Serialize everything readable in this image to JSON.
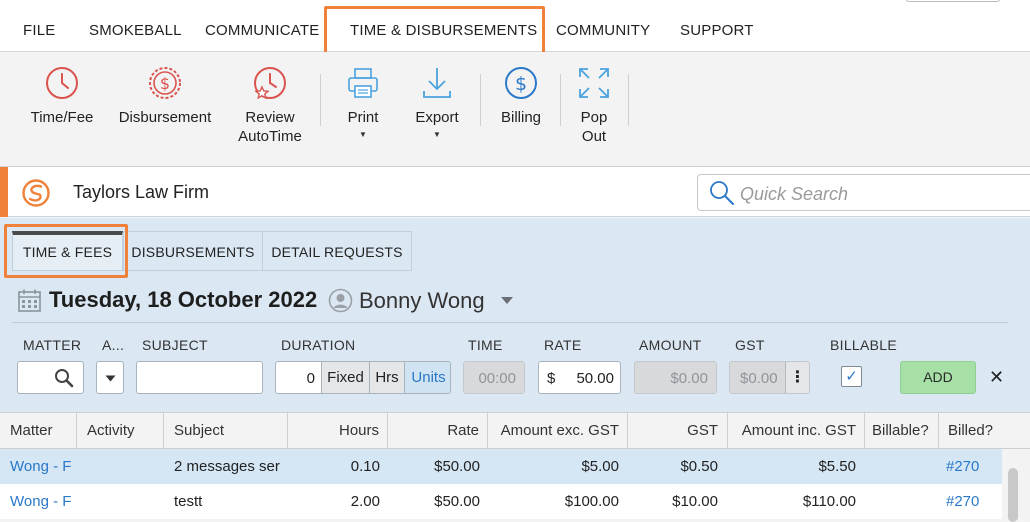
{
  "menu": {
    "items": [
      "FILE",
      "SMOKEBALL",
      "COMMUNICATE",
      "TIME & DISBURSEMENTS",
      "COMMUNITY",
      "SUPPORT"
    ],
    "active": "TIME & DISBURSEMENTS"
  },
  "ribbon": {
    "time_fee": "Time/Fee",
    "disbursement": "Disbursement",
    "review_line1": "Review",
    "review_line2": "AutoTime",
    "print": "Print",
    "export": "Export",
    "billing": "Billing",
    "popout_line1": "Pop",
    "popout_line2": "Out",
    "caret": "▼"
  },
  "firm": {
    "name": "Taylors Law Firm"
  },
  "search": {
    "placeholder": "Quick Search"
  },
  "tabs": [
    "TIME & FEES",
    "DISBURSEMENTS",
    "DETAIL REQUESTS"
  ],
  "header": {
    "date": "Tuesday, 18 October 2022",
    "person": "Bonny Wong"
  },
  "entry": {
    "labels": {
      "matter": "MATTER",
      "activity": "A...",
      "subject": "SUBJECT",
      "duration": "DURATION",
      "time": "TIME",
      "rate": "RATE",
      "amount": "AMOUNT",
      "gst": "GST",
      "billable": "BILLABLE"
    },
    "duration_value": "0",
    "duration_modes": [
      "Fixed",
      "Hrs",
      "Units"
    ],
    "time_value": "00:00",
    "rate_currency": "$",
    "rate_value": "50.00",
    "amount_value": "$0.00",
    "gst_value": "$0.00",
    "more": "⋮",
    "billable_check": "✓",
    "add": "ADD",
    "close": "✕"
  },
  "table": {
    "headers": [
      "Matter",
      "Activity",
      "Subject",
      "Hours",
      "Rate",
      "Amount exc. GST",
      "GST",
      "Amount inc. GST",
      "Billable?",
      "Billed?"
    ],
    "rows": [
      {
        "matter": "Wong - F",
        "activity": "",
        "subject": "2 messages ser",
        "hours": "0.10",
        "rate": "$50.00",
        "amount_exc": "$5.00",
        "gst": "$0.50",
        "amount_inc": "$5.50",
        "billable": "",
        "billed": "#270"
      },
      {
        "matter": "Wong - F",
        "activity": "",
        "subject": "testt",
        "hours": "2.00",
        "rate": "$50.00",
        "amount_exc": "$100.00",
        "gst": "$10.00",
        "amount_inc": "$110.00",
        "billable": "",
        "billed": "#270"
      }
    ]
  },
  "colors": {
    "accent": "#f0813b",
    "link": "#2a78c8",
    "icon_red": "#d9534f",
    "icon_blue": "#4aa3df",
    "add_green": "#a6e0a6"
  }
}
